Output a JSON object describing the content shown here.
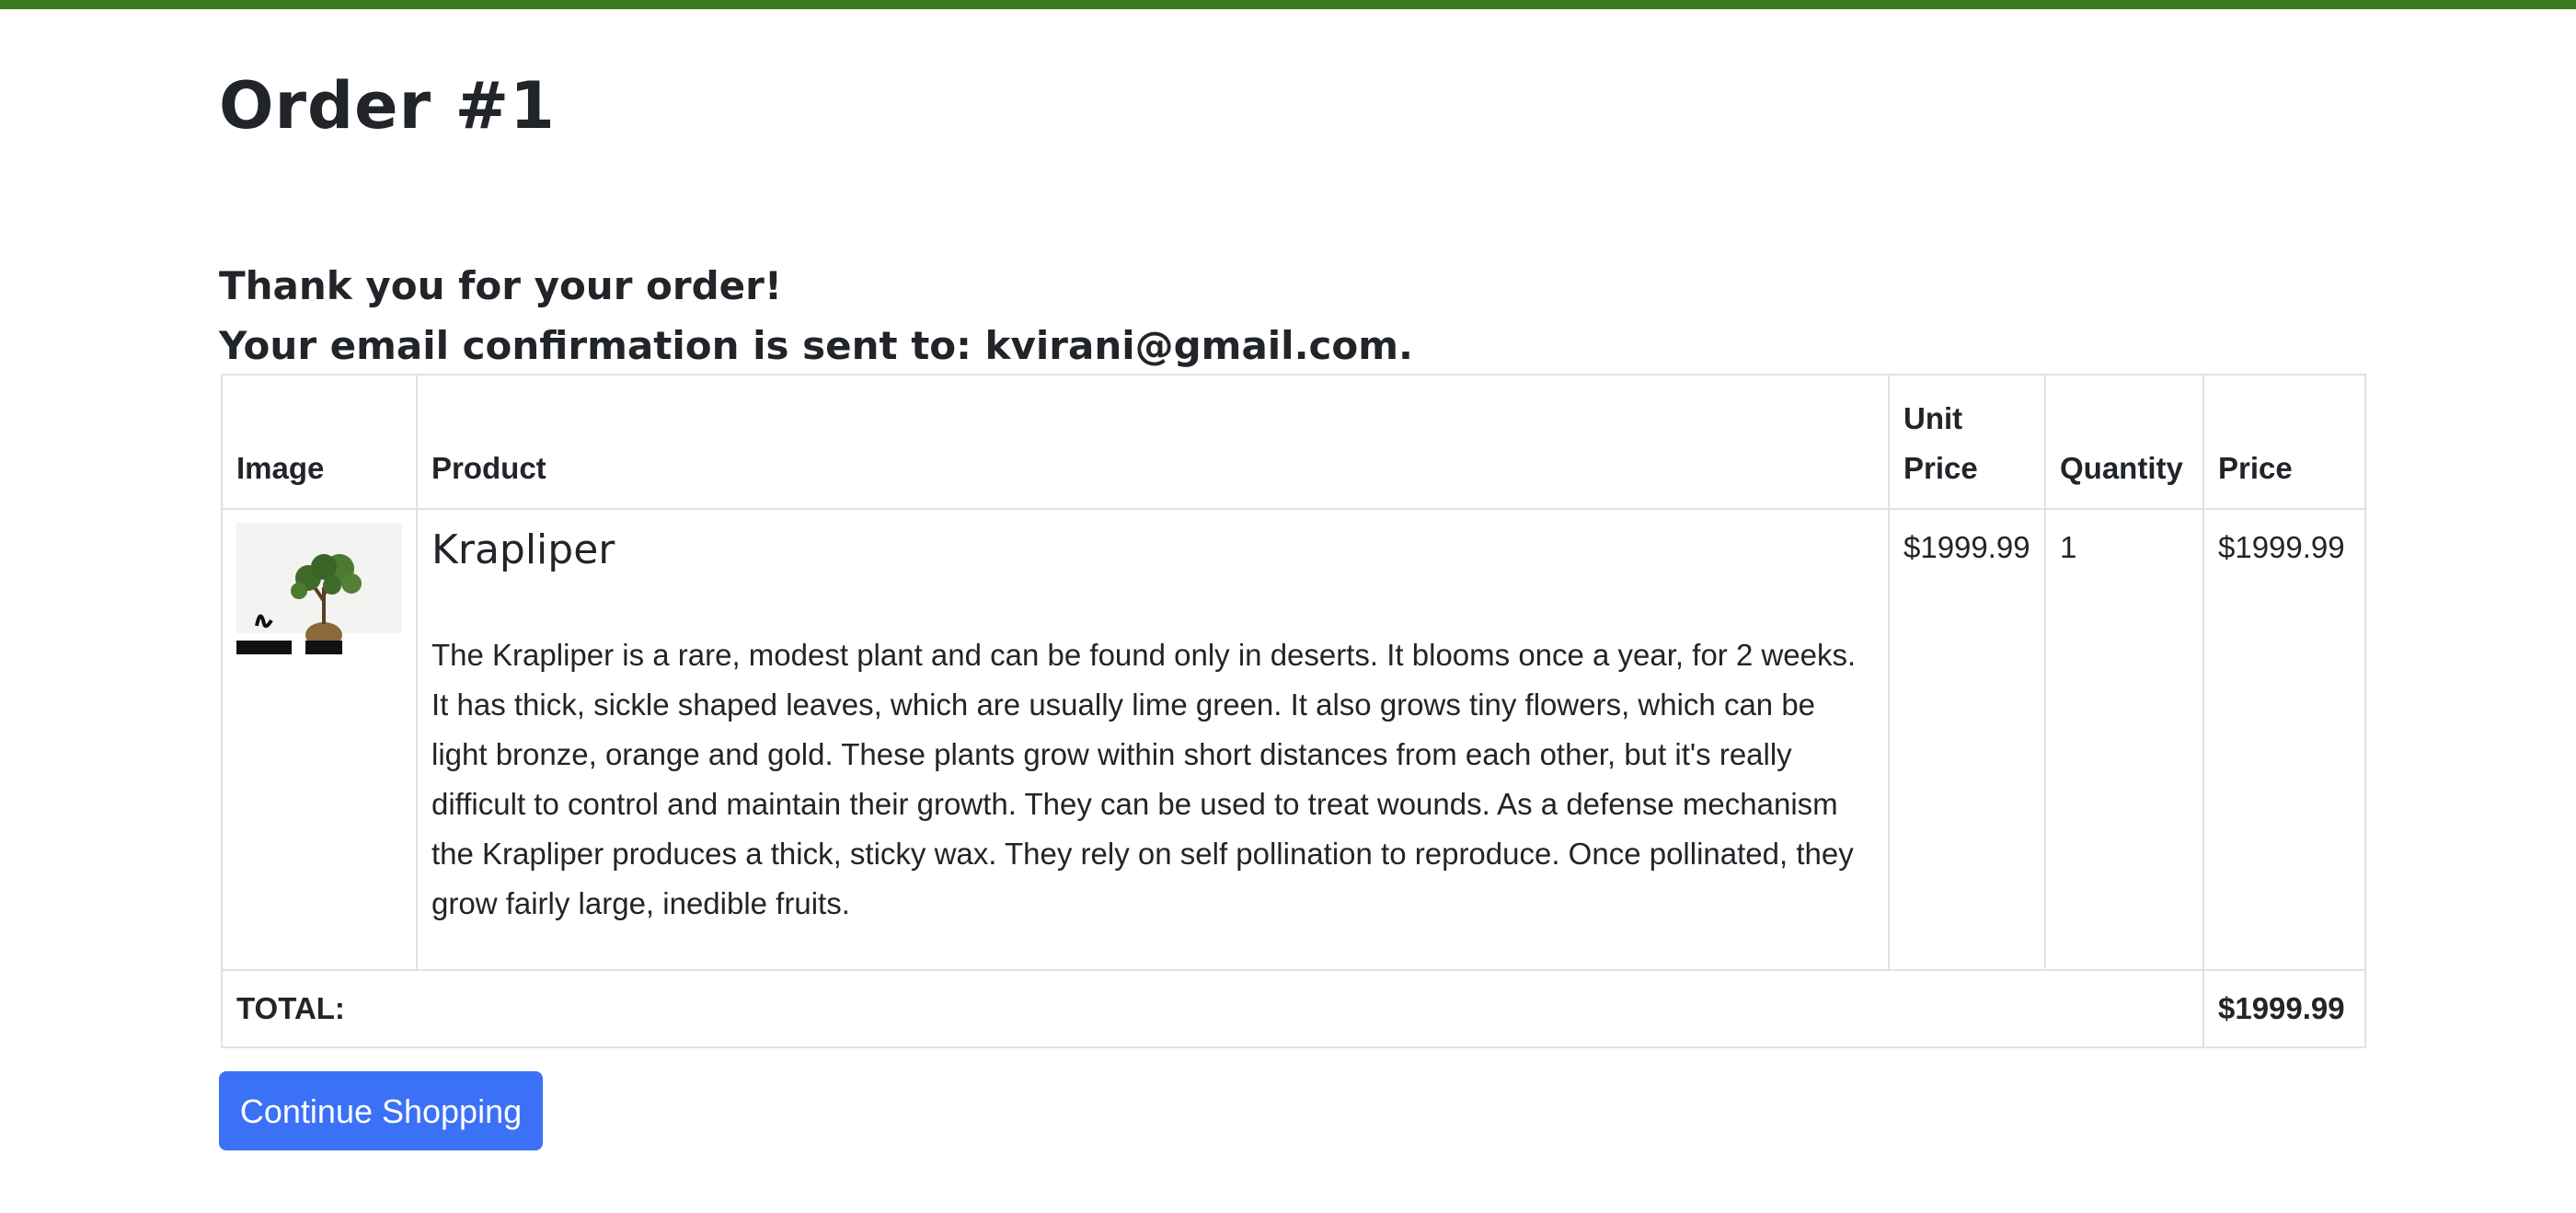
{
  "colors": {
    "top_bar": "#3b7a1e",
    "button_bg": "#3b71f6",
    "button_text": "#ffffff",
    "border": "#dee2e6",
    "text": "#212529"
  },
  "page": {
    "title": "Order #1",
    "thank_you": "Thank you for your order!",
    "email_confirmation": "Your email confirmation is sent to: kvirani@gmail.com."
  },
  "table": {
    "headers": {
      "image": "Image",
      "product": "Product",
      "unit_price": "Unit Price",
      "quantity": "Quantity",
      "price": "Price"
    },
    "rows": [
      {
        "image_icon": "plant-thumbnail",
        "product_name": "Krapliper",
        "description": "The Krapliper is a rare, modest plant and can be found only in deserts. It blooms once a year, for 2 weeks. It has thick, sickle shaped leaves, which are usually lime green. It also grows tiny flowers, which can be light bronze, orange and gold. These plants grow within short distances from each other, but it's really difficult to control and maintain their growth. They can be used to treat wounds. As a defense mechanism the Krapliper produces a thick, sticky wax. They rely on self pollination to reproduce. Once pollinated, they grow fairly large, inedible fruits.",
        "unit_price": "$1999.99",
        "quantity": "1",
        "price": "$1999.99"
      }
    ],
    "total_label": "TOTAL:",
    "total_value": "$1999.99"
  },
  "actions": {
    "continue_shopping": "Continue Shopping"
  }
}
